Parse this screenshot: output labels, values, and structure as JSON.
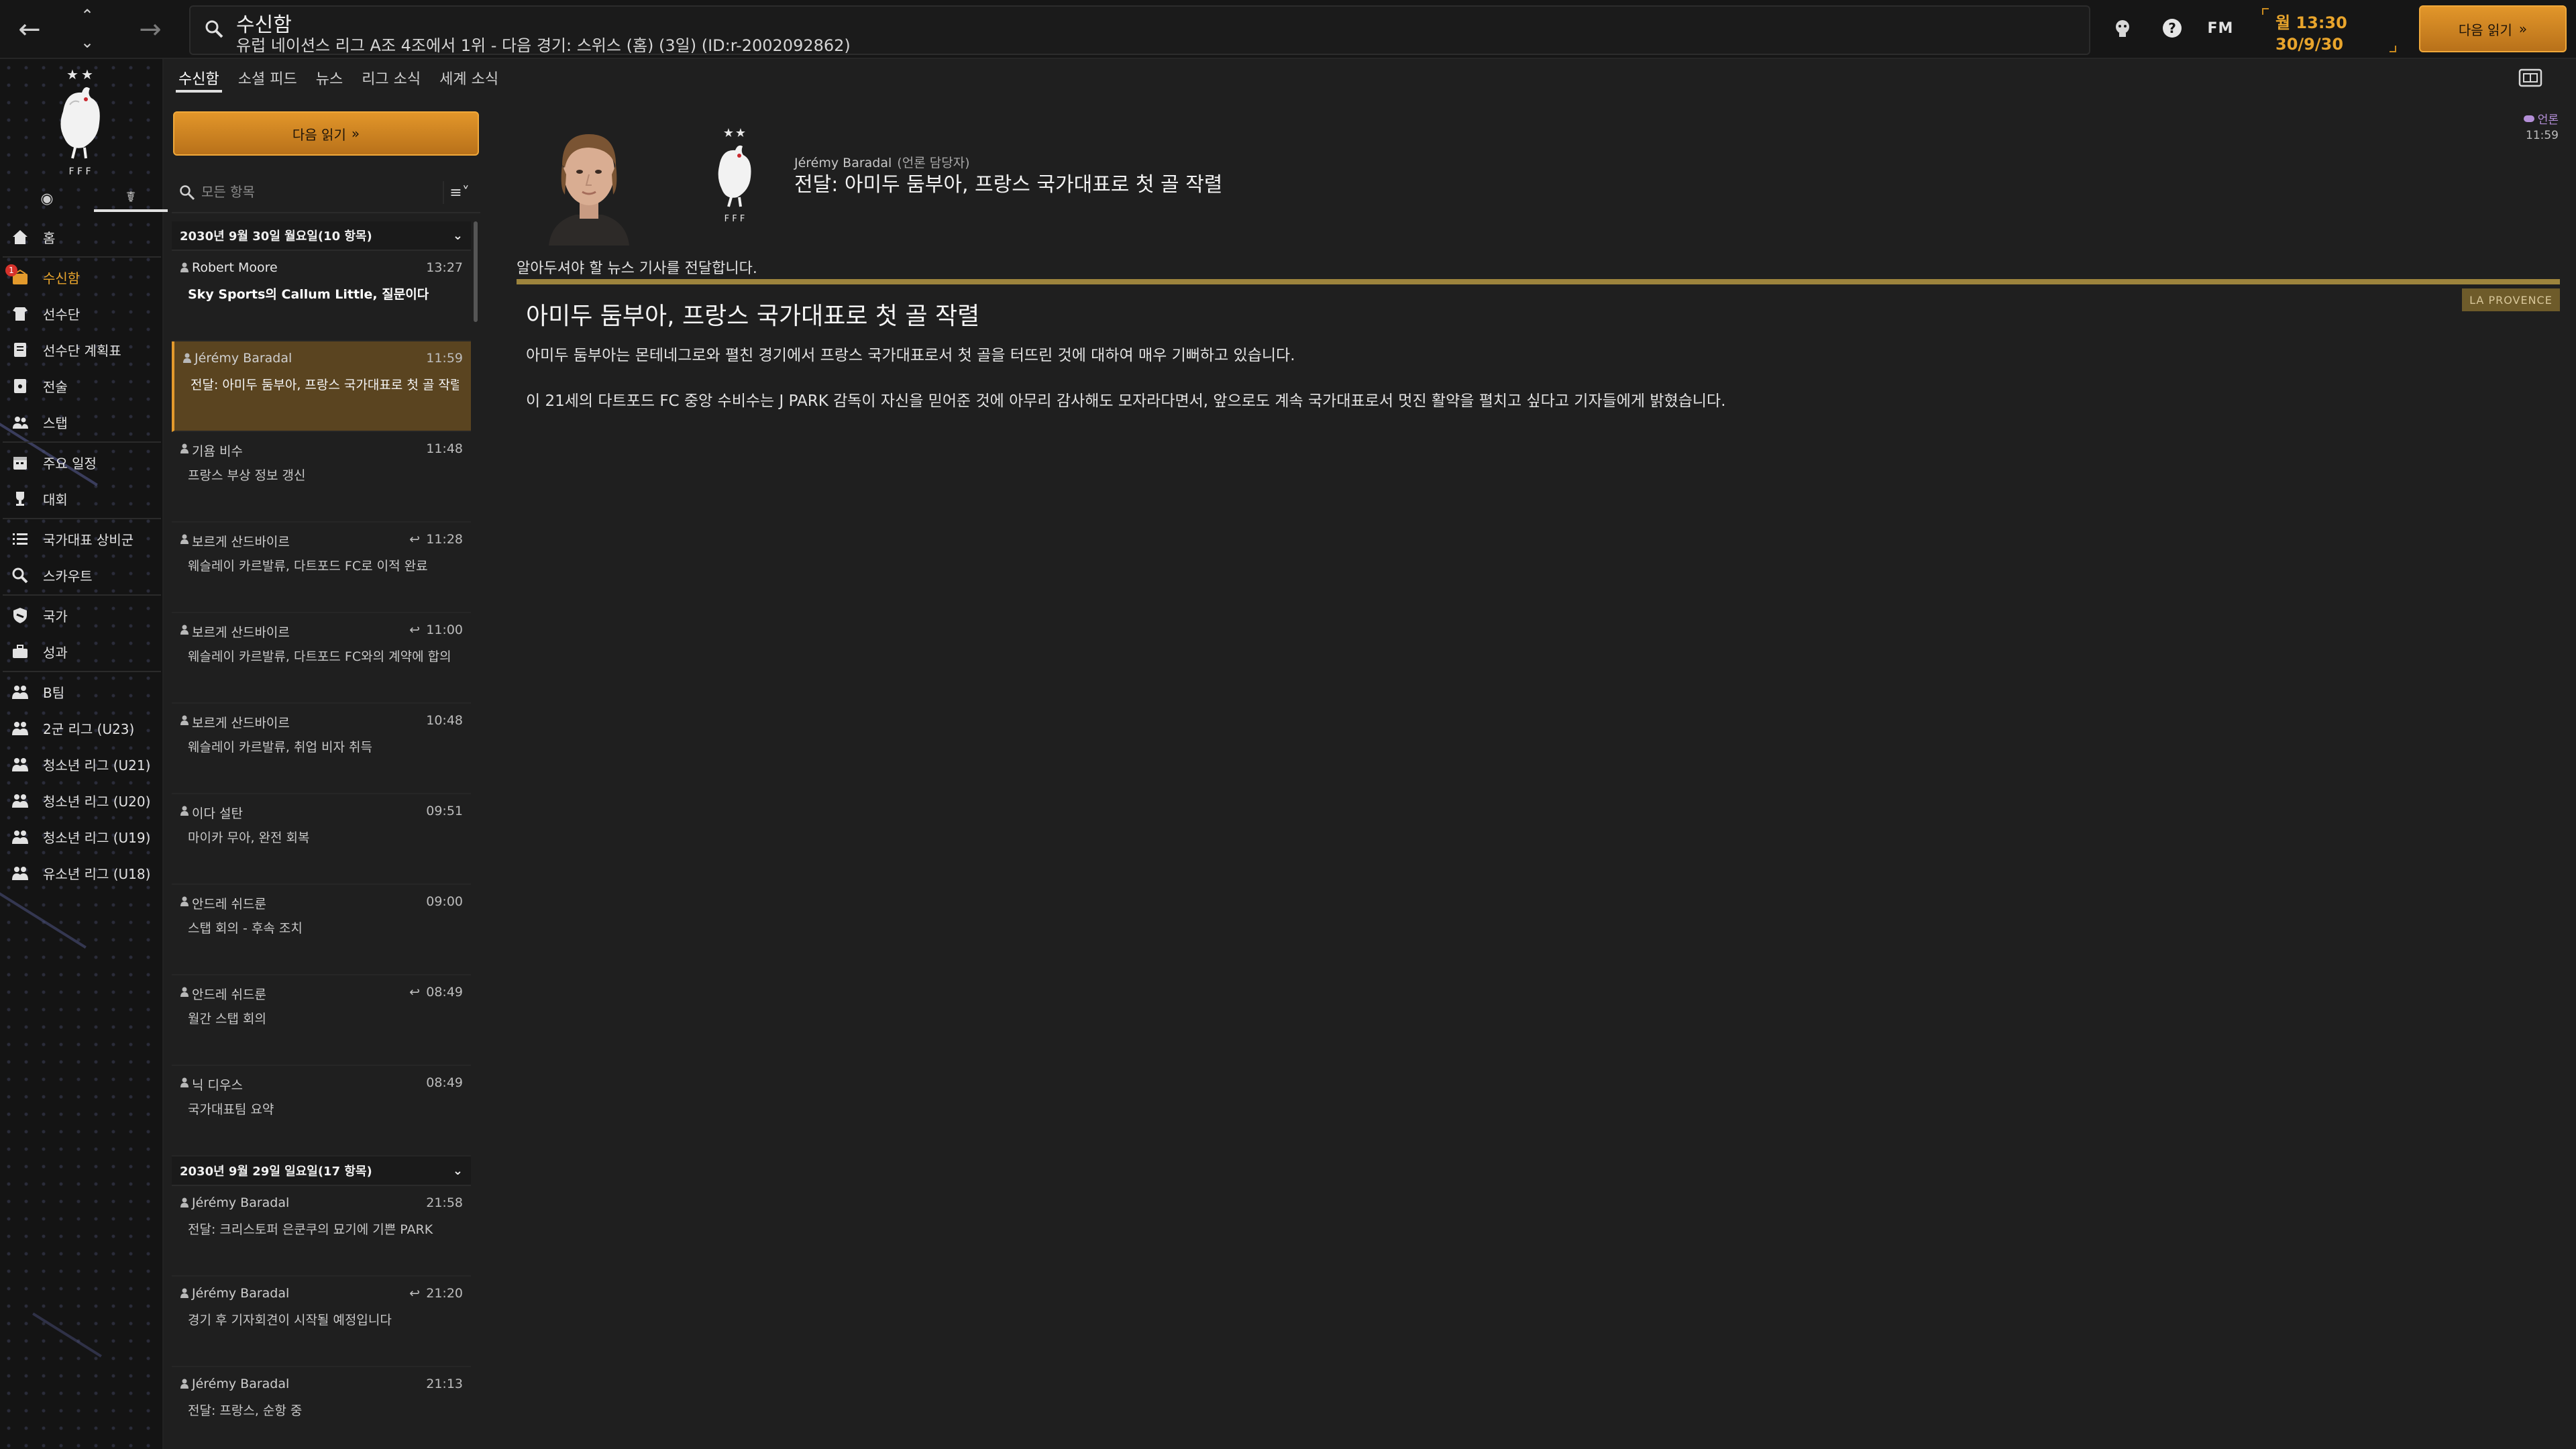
{
  "header": {
    "title": "수신함",
    "subtitle": "유럽 네이션스 리그 A조 4조에서 1위 - 다음 경기: 스위스 (홈) (3일) (ID:r-2002092862)",
    "fm_label": "FM",
    "time": "월 13:30",
    "date": "30/9/30",
    "continue_label": "다음 읽기"
  },
  "sidebar": {
    "items": [
      {
        "label": "홈",
        "icon": "home-icon"
      },
      {
        "label": "수신함",
        "icon": "inbox-icon",
        "badge": "1",
        "active": true
      },
      {
        "label": "선수단",
        "icon": "squad-icon"
      },
      {
        "label": "선수단 계획표",
        "icon": "squad-planner-icon"
      },
      {
        "label": "전술",
        "icon": "tactics-icon"
      },
      {
        "label": "스탭",
        "icon": "staff-icon"
      },
      {
        "label": "주요 일정",
        "icon": "calendar-icon"
      },
      {
        "label": "대회",
        "icon": "trophy-icon"
      },
      {
        "label": "국가대표 상비군",
        "icon": "list-icon"
      },
      {
        "label": "스카우트",
        "icon": "scout-icon"
      },
      {
        "label": "국가",
        "icon": "shield-icon"
      },
      {
        "label": "성과",
        "icon": "performance-icon"
      },
      {
        "label": "B팀",
        "icon": "team-icon"
      },
      {
        "label": "2군 리그 (U23)",
        "icon": "team-icon"
      },
      {
        "label": "청소년 리그 (U21)",
        "icon": "team-icon"
      },
      {
        "label": "청소년 리그 (U20)",
        "icon": "team-icon"
      },
      {
        "label": "청소년 리그 (U19)",
        "icon": "team-icon"
      },
      {
        "label": "유소년 리그 (U18)",
        "icon": "team-icon"
      }
    ]
  },
  "tabs": [
    "수신함",
    "소셜 피드",
    "뉴스",
    "리그 소식",
    "세계 소식"
  ],
  "inbox": {
    "continue_label": "다음 읽기",
    "filter_placeholder": "모든 항목",
    "groups": [
      {
        "header": "2030년 9월 30일 월요일(10 항목)",
        "messages": [
          {
            "sender": "Robert Moore",
            "time": "13:27",
            "subject": "Sky Sports의 Callum Little, 질문이다",
            "unread": true
          },
          {
            "sender": "Jérémy Baradal",
            "time": "11:59",
            "subject": "전달: 아미두 둠부아, 프랑스 국가대표로 첫 골 작렬",
            "selected": true
          },
          {
            "sender": "기욤 비수",
            "time": "11:48",
            "subject": "프랑스 부상 정보 갱신"
          },
          {
            "sender": "보르게 산드바이르",
            "time": "11:28",
            "subject": "웨슬레이 카르발류, 다트포드 FC로 이적 완료",
            "reply": true
          },
          {
            "sender": "보르게 산드바이르",
            "time": "11:00",
            "subject": "웨슬레이 카르발류, 다트포드 FC와의 계약에 합의",
            "reply": true
          },
          {
            "sender": "보르게 산드바이르",
            "time": "10:48",
            "subject": "웨슬레이 카르발류, 취업 비자 취득"
          },
          {
            "sender": "이다 설탄",
            "time": "09:51",
            "subject": "마이카 무아, 완전 회복"
          },
          {
            "sender": "안드레 쉬드룬",
            "time": "09:00",
            "subject": "스탭 회의 - 후속 조치"
          },
          {
            "sender": "안드레 쉬드룬",
            "time": "08:49",
            "subject": "월간 스탭 회의",
            "reply": true
          },
          {
            "sender": "닉 디우스",
            "time": "08:49",
            "subject": "국가대표팀 요약"
          }
        ]
      },
      {
        "header": "2030년 9월 29일 일요일(17 항목)",
        "messages": [
          {
            "sender": "Jérémy Baradal",
            "time": "21:58",
            "subject": "전달: 크리스토퍼 은쿤쿠의 묘기에 기쁜 PARK"
          },
          {
            "sender": "Jérémy Baradal",
            "time": "21:20",
            "subject": "경기 후 기자회견이 시작될 예정입니다",
            "reply": true
          },
          {
            "sender": "Jérémy Baradal",
            "time": "21:13",
            "subject": "전달: 프랑스, 순항 중"
          }
        ]
      }
    ]
  },
  "message": {
    "sender": "Jérémy Baradal",
    "sender_role": "(언론 담당자)",
    "subject": "전달: 아미두 둠부아, 프랑스 국가대표로 첫 골 작렬",
    "tag": "언론",
    "time": "11:59",
    "intro": "알아두셔야 할 뉴스 기사를 전달합니다.",
    "source": "LA PROVENCE",
    "article_title": "아미두 둠부아, 프랑스 국가대표로 첫 골 작렬",
    "paragraph1": "아미두 둠부아는 몬테네그로와 펼친 경기에서 프랑스 국가대표로서 첫 골을 터뜨린 것에 대하여 매우 기뻐하고 있습니다.",
    "paragraph2": "이 21세의 다트포드 FC 중앙 수비수는 J PARK 감독이 자신을 믿어준 것에 아무리 감사해도 모자라다면서, 앞으로도 계속 국가대표로서 멋진 활약을 펼치고 싶다고 기자들에게 밝혔습니다."
  },
  "colors": {
    "accent": "#e39a2c",
    "selected_row": "#5a4420",
    "divider_gold": "#9d843d",
    "tag_purple": "#b48fd8"
  }
}
